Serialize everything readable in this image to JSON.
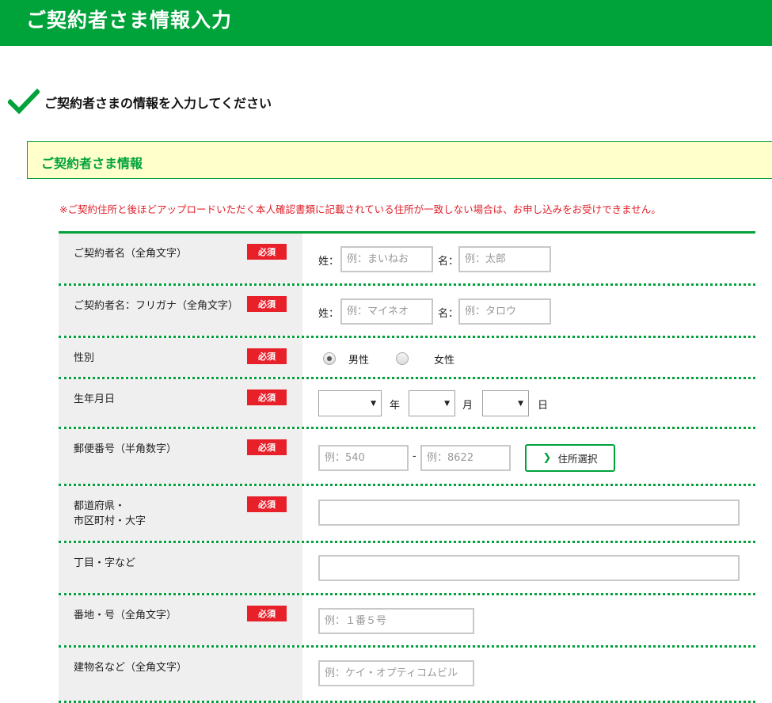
{
  "header": {
    "title": "ご契約者さま情報入力"
  },
  "lead": {
    "text": "ご契約者さまの情報を入力してください"
  },
  "section": {
    "title": "ご契約者さま情報"
  },
  "notice": {
    "text": "※ご契約住所と後ほどアップロードいただく本人確認書類に記載されている住所が一致しない場合は、お申し込みをお受けできません。"
  },
  "required_label": "必須",
  "rows": {
    "name": {
      "label": "ご契約者名（全角文字）",
      "last_label": "姓：",
      "last_placeholder": "例：まいねお",
      "first_label": "名：",
      "first_placeholder": "例：太郎"
    },
    "kana": {
      "label": "ご契約者名：フリガナ（全角文字）",
      "last_label": "姓：",
      "last_placeholder": "例：マイネオ",
      "first_label": "名：",
      "first_placeholder": "例：タロウ"
    },
    "gender": {
      "label": "性別",
      "options": [
        "男性",
        "女性"
      ],
      "selected": "男性"
    },
    "birthday": {
      "label": "生年月日",
      "year_unit": "年",
      "month_unit": "月",
      "day_unit": "日"
    },
    "postal": {
      "label": "郵便番号（半角数字）",
      "first_placeholder": "例：540",
      "separator": "-",
      "second_placeholder": "例：8622",
      "button_label": "住所選択"
    },
    "prefecture": {
      "label_line1": "都道府県・",
      "label_line2": "市区町村・大字"
    },
    "chome": {
      "label": "丁目・字など"
    },
    "banchi": {
      "label": "番地・号（全角文字）",
      "placeholder": "例：１番５号"
    },
    "building": {
      "label": "建物名など（全角文字）",
      "placeholder": "例：ケイ・オプティコムビル"
    }
  },
  "colors": {
    "brand_green": "#00a23a",
    "required_red": "#e8202a",
    "section_bg": "#ffffcc"
  }
}
